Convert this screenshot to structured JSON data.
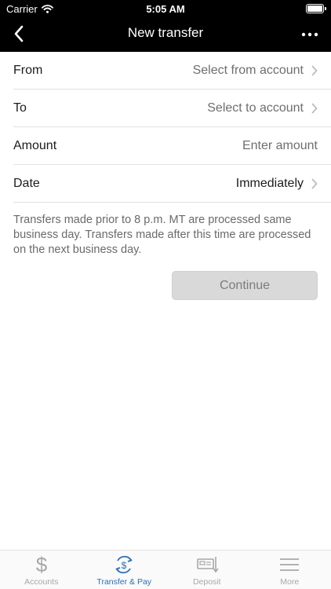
{
  "status_bar": {
    "carrier": "Carrier",
    "time": "5:05 AM"
  },
  "nav": {
    "title": "New transfer",
    "back_icon": "chevron-left-icon",
    "menu_icon": "more-horizontal-icon"
  },
  "form": {
    "from": {
      "label": "From",
      "value": "Select from account"
    },
    "to": {
      "label": "To",
      "value": "Select to account"
    },
    "amount": {
      "label": "Amount",
      "placeholder": "Enter amount"
    },
    "date": {
      "label": "Date",
      "value": "Immediately"
    }
  },
  "note": "Transfers made prior to 8 p.m. MT are processed same business day. Transfers made after this time are processed on the next business day.",
  "continue_label": "Continue",
  "tabs": [
    {
      "label": "Accounts",
      "icon": "dollar-icon",
      "active": false
    },
    {
      "label": "Transfer & Pay",
      "icon": "transfer-pay-icon",
      "active": true
    },
    {
      "label": "Deposit",
      "icon": "deposit-check-icon",
      "active": false
    },
    {
      "label": "More",
      "icon": "menu-lines-icon",
      "active": false
    }
  ],
  "colors": {
    "header_bg": "#000000",
    "active_tab": "#2a6fb8",
    "inactive_tab": "#a8a8a8",
    "button_bg": "#d9d9d9"
  }
}
